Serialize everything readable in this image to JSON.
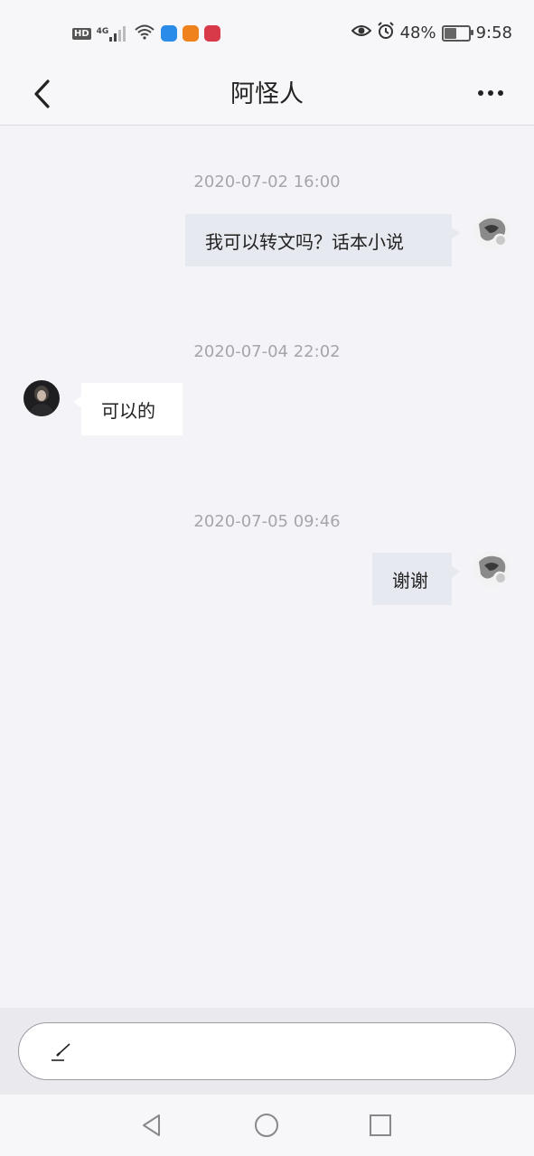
{
  "status_bar": {
    "hd": "HD",
    "network": "4G",
    "battery": "48%",
    "battery_level": 0.48,
    "time": "9:58",
    "icons": [
      "hd-icon",
      "signal-icon",
      "wifi-icon",
      "app-icon-blue",
      "app-icon-orange",
      "app-icon-red",
      "eye-icon",
      "alarm-icon",
      "battery-icon"
    ]
  },
  "header": {
    "title": "阿怪人",
    "back_icon": "chevron-left-icon",
    "more_icon": "more-dots-icon"
  },
  "messages": [
    {
      "timestamp": "2020-07-02 16:00",
      "direction": "outgoing",
      "text": "我可以转文吗？话本小说"
    },
    {
      "timestamp": "2020-07-04 22:02",
      "direction": "incoming",
      "text": "可以的"
    },
    {
      "timestamp": "2020-07-05 09:46",
      "direction": "outgoing",
      "text": "谢谢"
    }
  ],
  "composer": {
    "placeholder": "",
    "icon": "pen-icon"
  },
  "system_nav": {
    "icons": [
      "back-triangle-icon",
      "home-circle-icon",
      "recents-square-icon"
    ]
  },
  "colors": {
    "background": "#f4f4f8",
    "bubble_outgoing": "#e6e9ef",
    "bubble_incoming": "#ffffff",
    "timestamp": "#a5a5ad"
  }
}
